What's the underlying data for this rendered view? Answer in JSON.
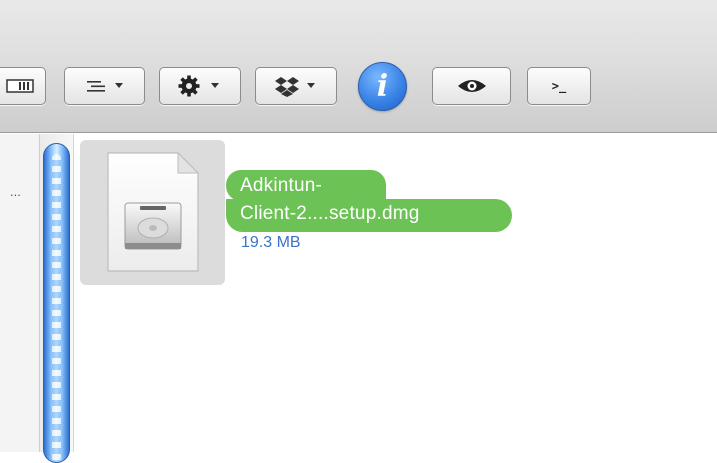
{
  "toolbar": {
    "buttons": [
      {
        "name": "view-mode-icon"
      },
      {
        "name": "arrange-icon"
      },
      {
        "name": "gear-icon"
      },
      {
        "name": "dropbox-icon"
      },
      {
        "name": "info-icon"
      },
      {
        "name": "quick-look-icon"
      },
      {
        "name": "terminal-icon",
        "label": ">_"
      }
    ],
    "info_label": "i"
  },
  "sidebar": {
    "truncated_text": "..."
  },
  "file": {
    "name": "Adkintun-\nClient-2....setup.dmg",
    "size": "19.3 MB",
    "icon": "disk-image-icon",
    "selection_color": "#6cc255"
  },
  "colors": {
    "size_text": "#3a74c9",
    "scroll_thumb": "#4a90e2"
  }
}
